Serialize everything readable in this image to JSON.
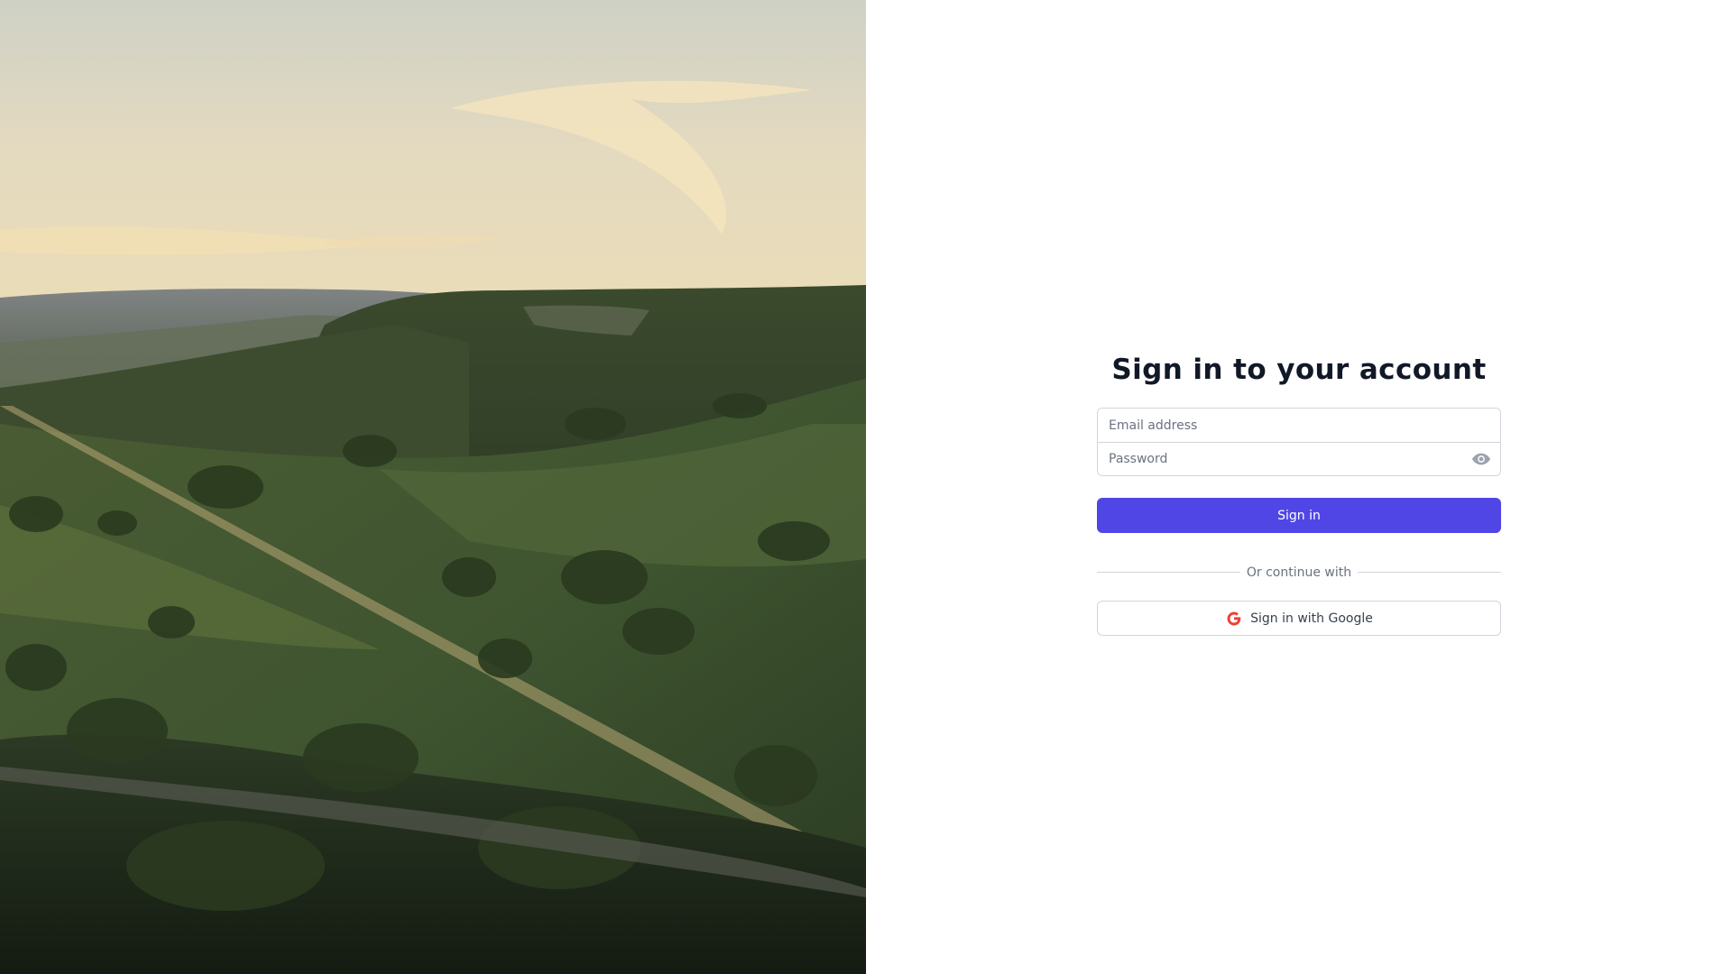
{
  "hero": {
    "image": "landscape-photo"
  },
  "login": {
    "title": "Sign in to your account",
    "email_placeholder": "Email address",
    "password_placeholder": "Password",
    "sign_in_label": "Sign in",
    "divider_text": "Or continue with",
    "google_label": "Sign in with Google"
  },
  "icons": {
    "password_toggle": "eye-icon",
    "google": "google-icon"
  },
  "colors": {
    "primary": "#4f46e5",
    "heading": "#111827",
    "border": "#d1d5db",
    "muted": "#6b7280",
    "google_red": "#ea4335"
  }
}
